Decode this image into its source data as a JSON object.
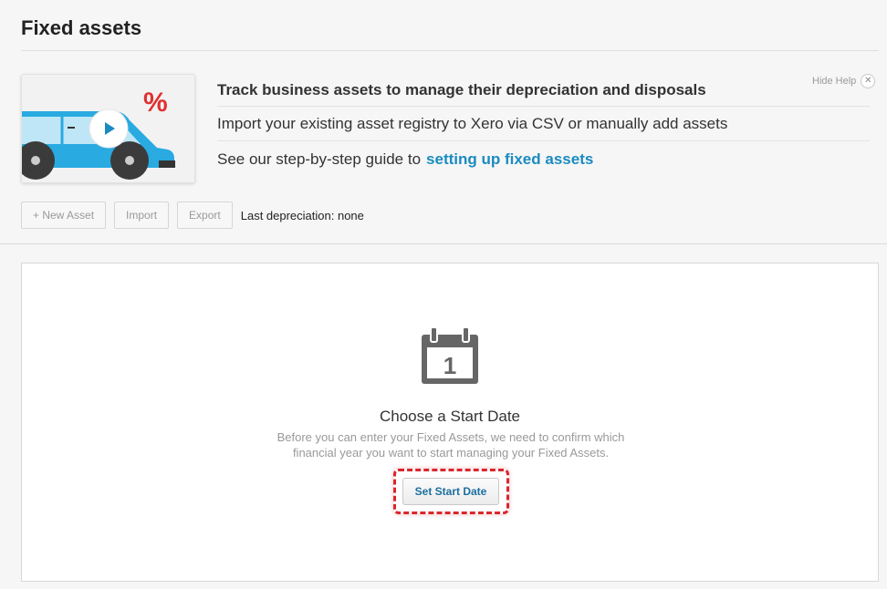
{
  "page": {
    "title": "Fixed assets"
  },
  "help": {
    "heading": "Track business assets to manage their depreciation and disposals",
    "line_import": "Import your existing asset registry to Xero via CSV or manually add assets",
    "guide_prefix": "See our step-by-step guide to",
    "guide_link": "setting up fixed assets",
    "hide_label": "Hide Help",
    "hide_icon": "close-icon",
    "video_icon": "play-icon",
    "thumb_symbol": "%"
  },
  "toolbar": {
    "new_asset": "+ New Asset",
    "import": "Import",
    "export": "Export",
    "last_depreciation": "Last depreciation: none"
  },
  "start_date": {
    "icon": "calendar-icon",
    "calendar_number": "1",
    "title": "Choose a Start Date",
    "description": "Before you can enter your Fixed Assets, we need to confirm which financial year you want to start managing your Fixed Assets.",
    "button": "Set Start Date"
  },
  "colors": {
    "link": "#1b8bc0",
    "highlight": "#d9272e",
    "car_body": "#29aae1",
    "percent": "#e03030"
  }
}
